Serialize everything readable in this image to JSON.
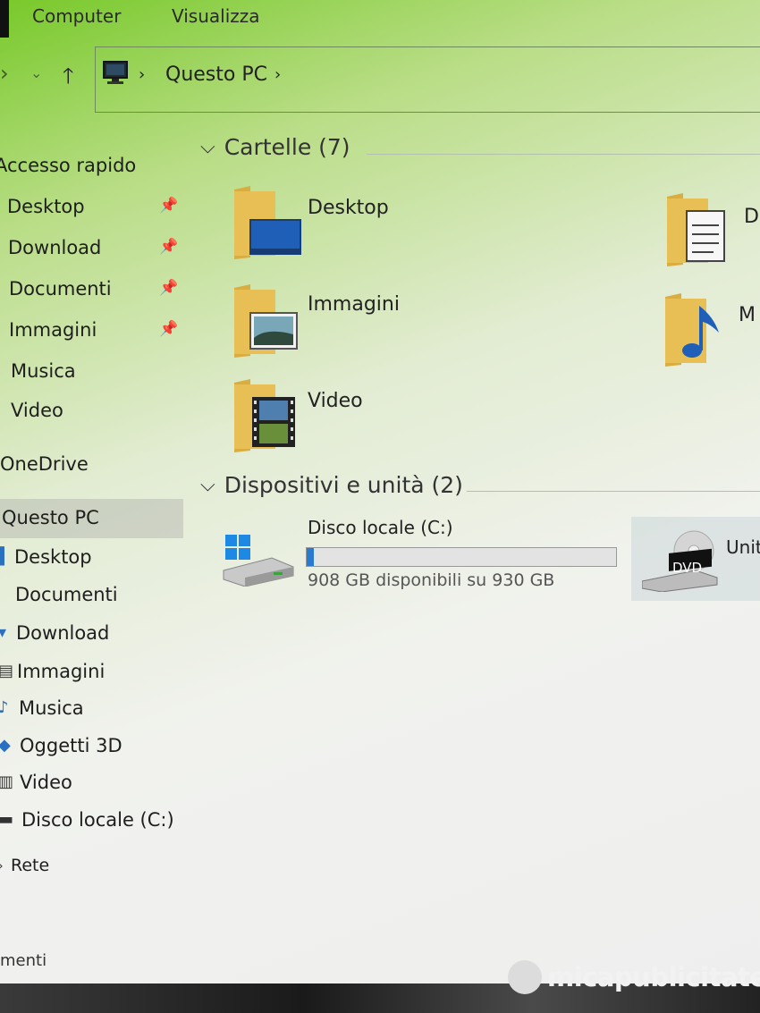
{
  "ribbon": {
    "tabs": [
      {
        "label": "Computer"
      },
      {
        "label": "Visualizza"
      }
    ]
  },
  "address": {
    "crumbs": [
      {
        "label": "Questo PC"
      }
    ]
  },
  "sidebar": {
    "quick_access": {
      "label": "Accesso rapido",
      "items": [
        {
          "label": "Desktop",
          "pinned": true
        },
        {
          "label": "Download",
          "pinned": true
        },
        {
          "label": "Documenti",
          "pinned": true
        },
        {
          "label": "Immagini",
          "pinned": true
        },
        {
          "label": "Musica"
        },
        {
          "label": "Video"
        }
      ]
    },
    "onedrive": {
      "label": "OneDrive"
    },
    "this_pc": {
      "label": "Questo PC",
      "selected": true,
      "items": [
        {
          "label": "Desktop"
        },
        {
          "label": "Documenti"
        },
        {
          "label": "Download"
        },
        {
          "label": "Immagini"
        },
        {
          "label": "Musica"
        },
        {
          "label": "Oggetti 3D"
        },
        {
          "label": "Video"
        },
        {
          "label": "Disco locale (C:)"
        }
      ]
    },
    "network": {
      "label": "Rete"
    }
  },
  "main": {
    "folders_section": {
      "title": "Cartelle (7)"
    },
    "folders": [
      {
        "name": "Desktop"
      },
      {
        "name": "D"
      },
      {
        "name": "Immagini"
      },
      {
        "name": "M"
      },
      {
        "name": "Video"
      }
    ],
    "devices_section": {
      "title": "Dispositivi e unità (2)"
    },
    "drives": [
      {
        "name": "Disco locale (C:)",
        "info": "908 GB disponibili su 930 GB",
        "used_fraction": 0.024
      },
      {
        "name": "Unit",
        "badge": "DVD"
      }
    ]
  },
  "status": {
    "text": "menti"
  },
  "watermark": {
    "text": "micapublicitate"
  },
  "colors": {
    "accent_green": "#78c92a",
    "bar_fill": "#2a7bd0",
    "folder_yellow": "#e8bf55"
  }
}
